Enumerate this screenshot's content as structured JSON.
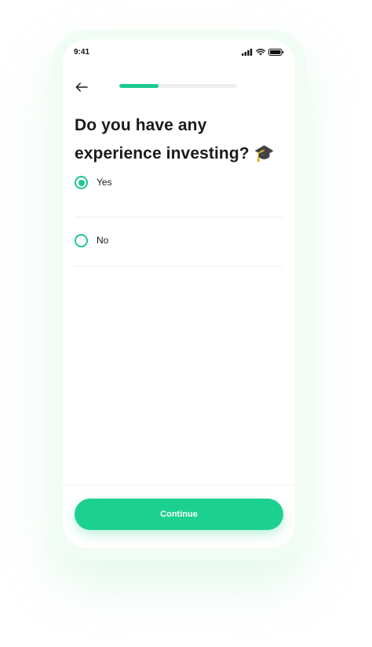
{
  "status_bar": {
    "time": "9:41",
    "icons": [
      "signal-icon",
      "wifi-icon",
      "battery-icon"
    ]
  },
  "header": {
    "back_icon": "arrow-left-icon",
    "progress_fraction": 0.33
  },
  "question": {
    "title": "Do you have any experience investing? 🎓"
  },
  "options": [
    {
      "label": "Yes",
      "selected": true
    },
    {
      "label": "No",
      "selected": false
    }
  ],
  "footer": {
    "continue_label": "Continue"
  },
  "colors": {
    "accent": "#1cd18f",
    "text": "#1a1a1a",
    "track": "#eeeeee"
  }
}
